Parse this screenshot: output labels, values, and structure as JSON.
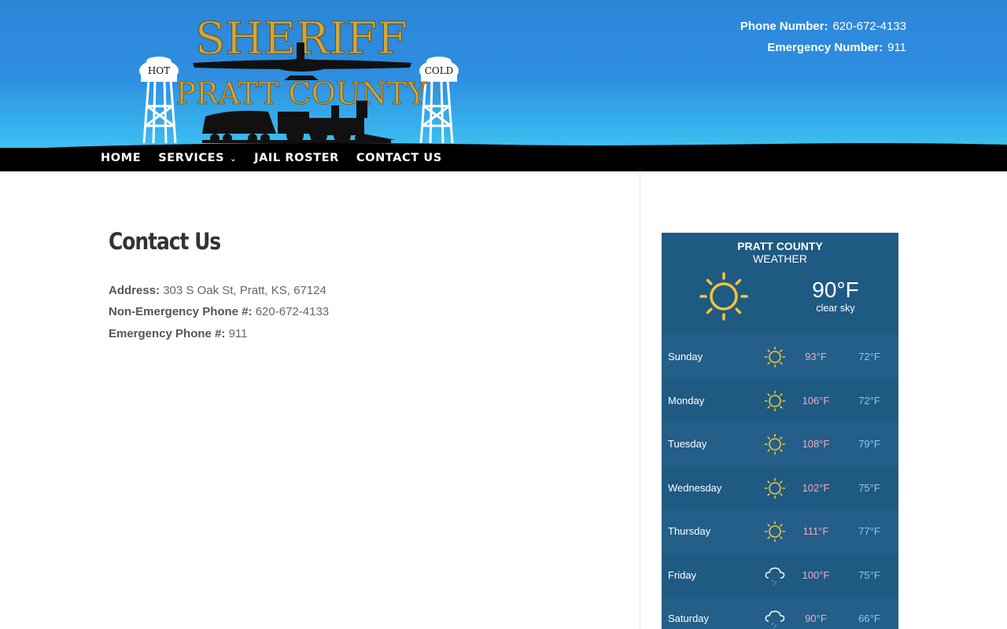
{
  "header": {
    "logo": {
      "title": "SHERIFF",
      "subtitle": "PRATT COUNTY",
      "tower_left": "HOT",
      "tower_right": "COLD"
    },
    "phone_label": "Phone Number:",
    "phone_value": "620-672-4133",
    "emergency_label": "Emergency Number:",
    "emergency_value": "911"
  },
  "nav": {
    "items": [
      {
        "label": "HOME"
      },
      {
        "label": "SERVICES"
      },
      {
        "label": "JAIL ROSTER"
      },
      {
        "label": "CONTACT US"
      }
    ]
  },
  "main": {
    "title": "Contact Us",
    "address_label": "Address:",
    "address_value": "303 S Oak St, Pratt, KS, 67124",
    "nonemergency_label": "Non-Emergency Phone #:",
    "nonemergency_value": "620-672-4133",
    "emergency_label": "Emergency Phone #:",
    "emergency_value": "911"
  },
  "weather": {
    "title": "PRATT COUNTY",
    "subtitle": "WEATHER",
    "current_icon": "sun-icon",
    "current_temp": "90°F",
    "current_desc": "clear sky",
    "colors": {
      "panel": "#1f5a83",
      "high": "#f2a8c0",
      "low": "#8ec7f1",
      "sun": "#f5c43a"
    },
    "days": [
      {
        "day": "Sunday",
        "icon": "sun-icon",
        "high": "93°F",
        "low": "72°F"
      },
      {
        "day": "Monday",
        "icon": "sun-icon",
        "high": "106°F",
        "low": "72°F"
      },
      {
        "day": "Tuesday",
        "icon": "sun-icon",
        "high": "108°F",
        "low": "79°F"
      },
      {
        "day": "Wednesday",
        "icon": "sun-icon",
        "high": "102°F",
        "low": "75°F"
      },
      {
        "day": "Thursday",
        "icon": "sun-icon",
        "high": "111°F",
        "low": "77°F"
      },
      {
        "day": "Friday",
        "icon": "rain-icon",
        "high": "100°F",
        "low": "75°F"
      },
      {
        "day": "Saturday",
        "icon": "rain-icon",
        "high": "90°F",
        "low": "66°F"
      }
    ]
  }
}
